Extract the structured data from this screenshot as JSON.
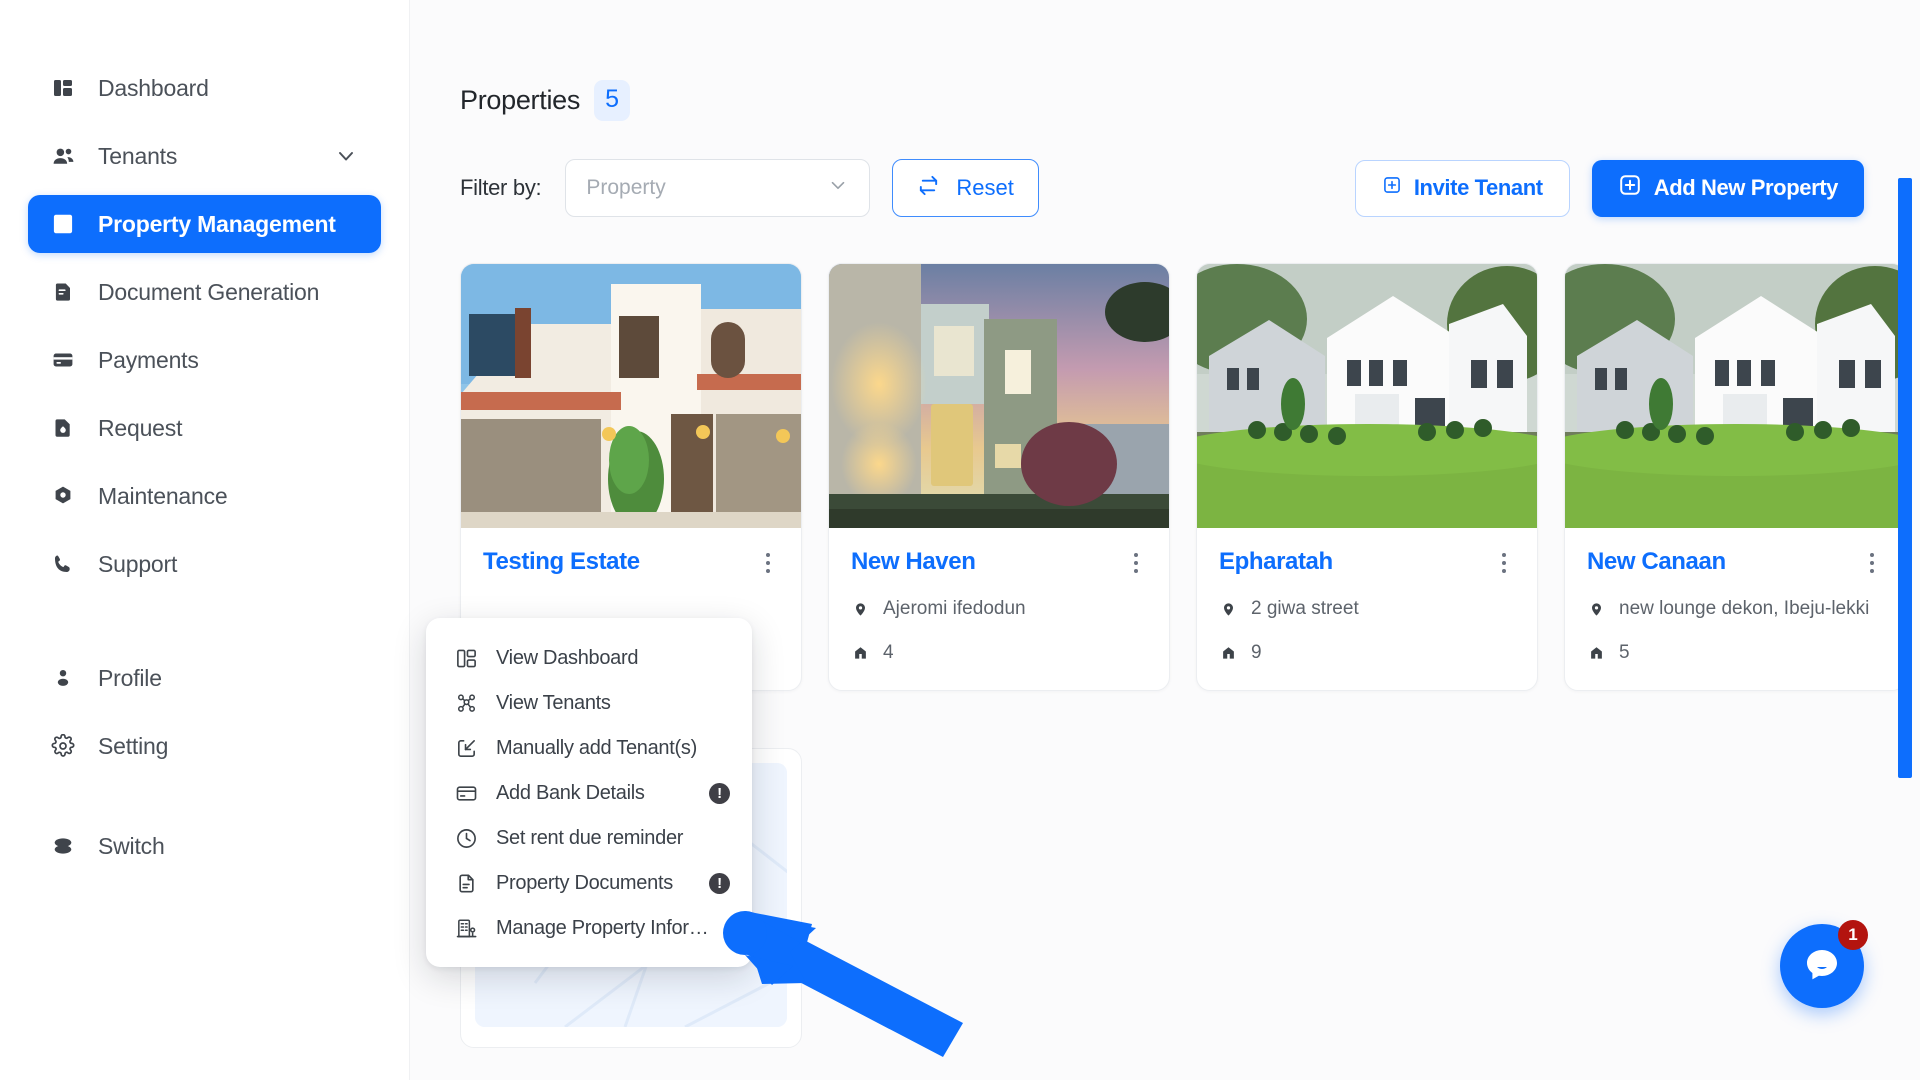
{
  "sidebar": {
    "items": [
      {
        "label": "Dashboard",
        "icon": "dashboard-icon",
        "active": false
      },
      {
        "label": "Tenants",
        "icon": "users-icon",
        "active": false,
        "chevron": true
      },
      {
        "label": "Property Management",
        "icon": "building-icon",
        "active": true
      },
      {
        "label": "Document Generation",
        "icon": "document-icon",
        "active": false
      },
      {
        "label": "Payments",
        "icon": "card-icon",
        "active": false
      },
      {
        "label": "Request",
        "icon": "request-icon",
        "active": false
      },
      {
        "label": "Maintenance",
        "icon": "nut-icon",
        "active": false
      },
      {
        "label": "Support",
        "icon": "phone-icon",
        "active": false
      }
    ],
    "secondary": [
      {
        "label": "Profile",
        "icon": "person-icon"
      },
      {
        "label": "Setting",
        "icon": "gear-icon"
      }
    ],
    "footer": [
      {
        "label": "Switch",
        "icon": "switch-icon"
      }
    ]
  },
  "header": {
    "title": "Properties",
    "count": "5"
  },
  "toolbar": {
    "filter_label": "Filter by:",
    "filter_placeholder": "Property",
    "filter_value": "",
    "reset_label": "Reset",
    "reset_icon": "refresh-icon",
    "invite_tenant_label": "Invite Tenant",
    "invite_tenant_icon": "plus-square-icon",
    "add_property_label": "Add New Property",
    "add_property_icon": "plus-square-icon"
  },
  "cards": [
    {
      "title": "Testing Estate",
      "address": "",
      "units": "",
      "image": "spanish-style-stucco-house-with-garage",
      "menu_open": true
    },
    {
      "title": "New Haven",
      "address": "Ajeromi ifedodun",
      "units": "4",
      "image": "modern-townhouse-at-dusk",
      "menu_open": false
    },
    {
      "title": "Epharatah",
      "address": "2 giwa street",
      "units": "9",
      "image": "white-farmhouse-with-green-lawn",
      "menu_open": false
    },
    {
      "title": "New Canaan",
      "address": "new lounge dekon, Ibeju-lekki",
      "units": "5",
      "image": "white-farmhouse-with-green-lawn",
      "menu_open": false
    }
  ],
  "card_meta_icons": {
    "address": "map-pin-icon",
    "units": "home-icon"
  },
  "context_menu": {
    "items": [
      {
        "label": "View Dashboard",
        "icon": "layout-dashboard-icon",
        "warning": false
      },
      {
        "label": "View Tenants",
        "icon": "users-group-icon",
        "warning": false
      },
      {
        "label": "Manually add Tenant(s)",
        "icon": "arrow-into-box-icon",
        "warning": false
      },
      {
        "label": "Add Bank Details",
        "icon": "credit-card-icon",
        "warning": true
      },
      {
        "label": "Set rent due reminder",
        "icon": "clock-icon",
        "warning": false
      },
      {
        "label": "Property Documents",
        "icon": "file-lines-icon",
        "warning": true
      },
      {
        "label": "Manage Property Infor…",
        "icon": "building-info-icon",
        "warning": false
      }
    ],
    "warning_glyph": "!"
  },
  "chat": {
    "icon": "chat-bubble-icon",
    "unread_count": "1"
  },
  "colors": {
    "accent": "#0d6efd",
    "badge_bg": "#e7f0ff",
    "text": "#3b4149",
    "muted": "#5d636b",
    "warning_dot": "#3f3f46",
    "chat_badge": "#b3140f",
    "annotation_arrow": "#0d6efd"
  }
}
